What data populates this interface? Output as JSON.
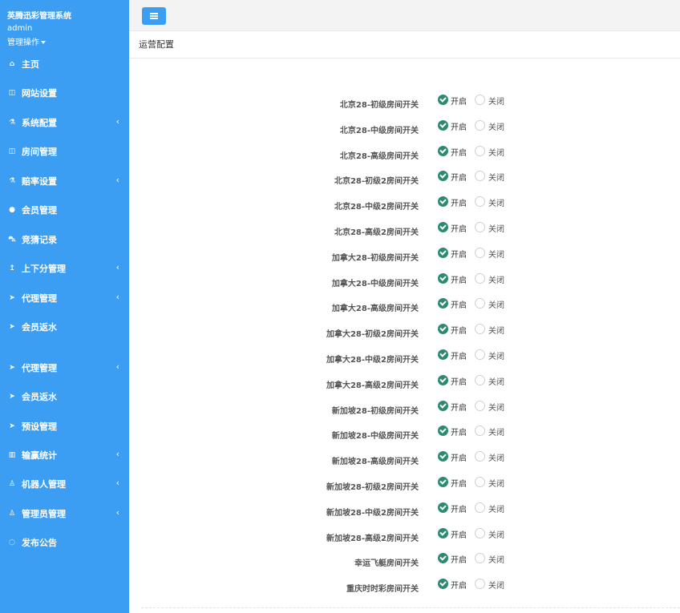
{
  "app": {
    "title": "英腾迅彩管理系统",
    "user": "admin",
    "user_menu": "管理操作"
  },
  "colors": {
    "sidebar": "#3c9ef3",
    "accent": "#3c9ef3",
    "radio_checked": "#2d8a6f"
  },
  "sidebar": {
    "items": [
      {
        "label": "主页",
        "icon": "home-icon",
        "glyph": "⌂",
        "arrow": ""
      },
      {
        "label": "网站设置",
        "icon": "columns-icon",
        "glyph": "◫",
        "arrow": ""
      },
      {
        "label": "系统配置",
        "icon": "flask-icon",
        "glyph": "⚗",
        "arrow": "‹"
      },
      {
        "label": "房间管理",
        "icon": "columns-icon",
        "glyph": "◫",
        "arrow": ""
      },
      {
        "label": "赔率设置",
        "icon": "flask-icon",
        "glyph": "⚗",
        "arrow": "‹"
      },
      {
        "label": "会员管理",
        "icon": "user-icon",
        "glyph": "●",
        "arrow": ""
      },
      {
        "label": "竞猜记录",
        "icon": "car-icon",
        "glyph": "⛍",
        "arrow": ""
      },
      {
        "label": "上下分管理",
        "icon": "level-up-icon",
        "glyph": "↥",
        "arrow": "‹"
      },
      {
        "label": "代理管理",
        "icon": "paper-plane-icon",
        "glyph": "➤",
        "arrow": "‹"
      },
      {
        "label": "会员返水",
        "icon": "paper-plane-icon",
        "glyph": "➤",
        "arrow": ""
      },
      {
        "label": "代理管理",
        "icon": "paper-plane-icon",
        "glyph": "➤",
        "arrow": "‹"
      },
      {
        "label": "会员返水",
        "icon": "paper-plane-icon",
        "glyph": "➤",
        "arrow": ""
      },
      {
        "label": "预设管理",
        "icon": "paper-plane-icon",
        "glyph": "➤",
        "arrow": ""
      },
      {
        "label": "输赢统计",
        "icon": "bar-chart-icon",
        "glyph": "▥",
        "arrow": "‹"
      },
      {
        "label": "机器人管理",
        "icon": "male-icon",
        "glyph": "♙",
        "arrow": "‹"
      },
      {
        "label": "管理员管理",
        "icon": "male-icon",
        "glyph": "♙",
        "arrow": "‹"
      },
      {
        "label": "发布公告",
        "icon": "comment-icon",
        "glyph": "◌",
        "arrow": ""
      }
    ]
  },
  "panel": {
    "title": "运营配置"
  },
  "options": {
    "on": "开启",
    "off": "关闭"
  },
  "switches": [
    {
      "label": "北京28-初级房间开关",
      "value": "on"
    },
    {
      "label": "北京28-中级房间开关",
      "value": "on"
    },
    {
      "label": "北京28-高级房间开关",
      "value": "on"
    },
    {
      "label": "北京28-初级2房间开关",
      "value": "on"
    },
    {
      "label": "北京28-中级2房间开关",
      "value": "on"
    },
    {
      "label": "北京28-高级2房间开关",
      "value": "on"
    },
    {
      "label": "加拿大28-初级房间开关",
      "value": "on"
    },
    {
      "label": "加拿大28-中级房间开关",
      "value": "on"
    },
    {
      "label": "加拿大28-高级房间开关",
      "value": "on"
    },
    {
      "label": "加拿大28-初级2房间开关",
      "value": "on"
    },
    {
      "label": "加拿大28-中级2房间开关",
      "value": "on"
    },
    {
      "label": "加拿大28-高级2房间开关",
      "value": "on"
    },
    {
      "label": "新加坡28-初级房间开关",
      "value": "on"
    },
    {
      "label": "新加坡28-中级房间开关",
      "value": "on"
    },
    {
      "label": "新加坡28-高级房间开关",
      "value": "on"
    },
    {
      "label": "新加坡28-初级2房间开关",
      "value": "on"
    },
    {
      "label": "新加坡28-中级2房间开关",
      "value": "on"
    },
    {
      "label": "新加坡28-高级2房间开关",
      "value": "on"
    },
    {
      "label": "幸运飞艇房间开关",
      "value": "on"
    },
    {
      "label": "重庆时时彩房间开关",
      "value": "on"
    }
  ]
}
